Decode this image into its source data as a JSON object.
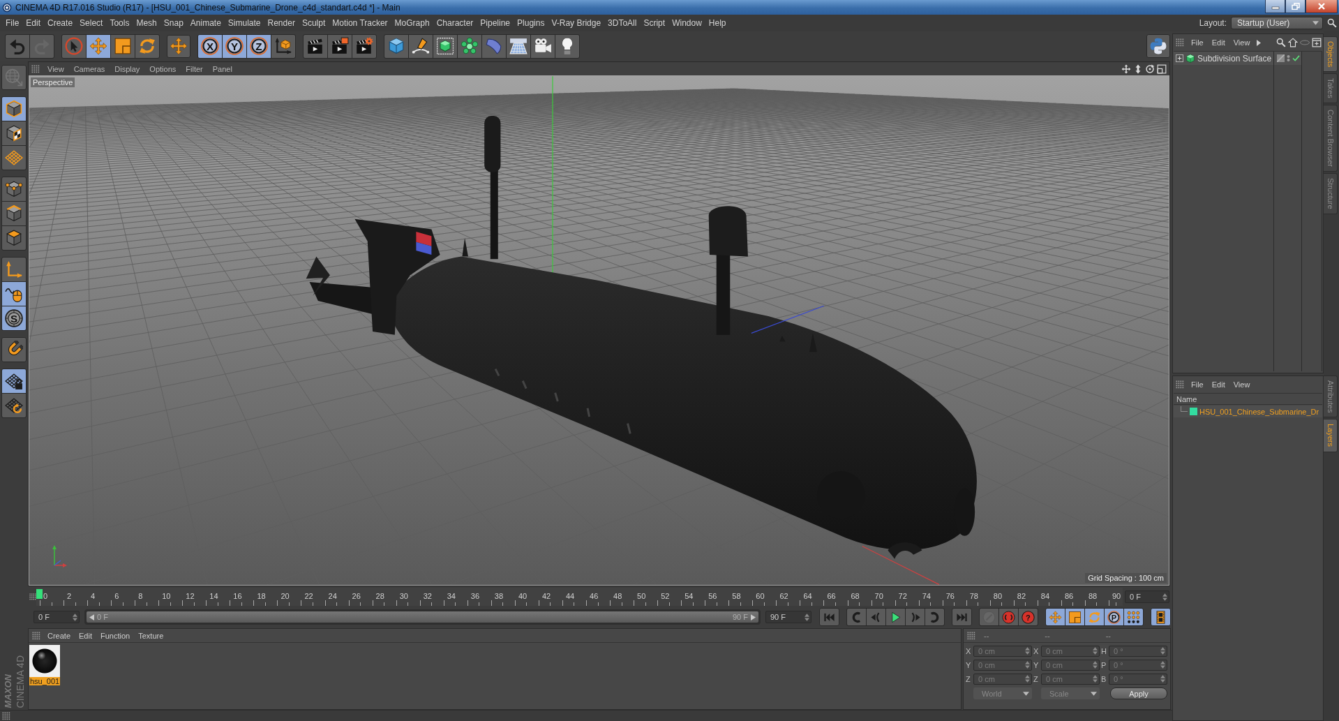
{
  "window": {
    "title": "CINEMA 4D R17.016 Studio (R17) - [HSU_001_Chinese_Submarine_Drone_c4d_standart.c4d *] - Main"
  },
  "menu_bar": {
    "items": [
      "File",
      "Edit",
      "Create",
      "Select",
      "Tools",
      "Mesh",
      "Snap",
      "Animate",
      "Simulate",
      "Render",
      "Sculpt",
      "Motion Tracker",
      "MoGraph",
      "Character",
      "Pipeline",
      "Plugins",
      "V-Ray Bridge",
      "3DToAll",
      "Script",
      "Window",
      "Help"
    ],
    "layout_label": "Layout:",
    "layout_value": "Startup (User)"
  },
  "toolbar": {
    "groups": [
      [
        {
          "kind": "undo",
          "selected": false,
          "disabled": false
        },
        {
          "kind": "redo",
          "selected": false,
          "disabled": true
        }
      ],
      [
        {
          "kind": "select",
          "selected": false,
          "disabled": false
        },
        {
          "kind": "move",
          "selected": true,
          "disabled": false
        },
        {
          "kind": "scale",
          "selected": false,
          "disabled": false
        },
        {
          "kind": "rotate",
          "selected": false,
          "disabled": false
        }
      ],
      [
        {
          "kind": "last_tool",
          "selected": false,
          "disabled": false
        }
      ],
      [
        {
          "kind": "axis_lock",
          "label": "X",
          "selected": true,
          "disabled": false
        },
        {
          "kind": "axis_lock",
          "label": "Y",
          "selected": true,
          "disabled": false
        },
        {
          "kind": "axis_lock",
          "label": "Z",
          "selected": true,
          "disabled": false
        },
        {
          "kind": "coordinate_system",
          "selected": false,
          "disabled": false
        }
      ],
      [
        {
          "kind": "render_view",
          "selected": false,
          "disabled": false
        },
        {
          "kind": "render_picture_viewer",
          "selected": false,
          "disabled": false
        },
        {
          "kind": "render_settings",
          "selected": false,
          "disabled": false
        }
      ],
      [
        {
          "kind": "cube",
          "selected": false,
          "disabled": false
        },
        {
          "kind": "pen",
          "selected": false,
          "disabled": false
        },
        {
          "kind": "subdivision",
          "selected": false,
          "disabled": false
        },
        {
          "kind": "cloner",
          "selected": false,
          "disabled": false
        },
        {
          "kind": "deformer",
          "selected": false,
          "disabled": false
        },
        {
          "kind": "floor",
          "selected": false,
          "disabled": false
        },
        {
          "kind": "camera",
          "selected": false,
          "disabled": false
        },
        {
          "kind": "light",
          "selected": false,
          "disabled": false
        }
      ]
    ],
    "right_groups": [
      [
        {
          "kind": "python",
          "selected": false,
          "disabled": false
        }
      ]
    ]
  },
  "side_toolbar": {
    "groups": [
      [
        {
          "kind": "make_editable",
          "selected": false,
          "disabled": true
        }
      ],
      [
        {
          "kind": "model",
          "selected": true,
          "disabled": false
        },
        {
          "kind": "texture",
          "selected": false,
          "disabled": false
        },
        {
          "kind": "workplane",
          "selected": false,
          "disabled": false
        }
      ],
      [
        {
          "kind": "points",
          "selected": false,
          "disabled": false
        },
        {
          "kind": "edges",
          "selected": false,
          "disabled": false
        },
        {
          "kind": "polygons",
          "selected": false,
          "disabled": false
        }
      ],
      [
        {
          "kind": "axis",
          "selected": false,
          "disabled": false
        },
        {
          "kind": "tweak",
          "selected": true,
          "disabled": false
        },
        {
          "kind": "solo",
          "label": "S",
          "selected": true,
          "disabled": false
        }
      ],
      [
        {
          "kind": "snap",
          "selected": false,
          "disabled": false
        }
      ],
      [
        {
          "kind": "lock_workplane",
          "selected": true,
          "disabled": false
        },
        {
          "kind": "planar_workplane",
          "selected": false,
          "disabled": false
        }
      ]
    ]
  },
  "viewport": {
    "menu": [
      "View",
      "Cameras",
      "Display",
      "Options",
      "Filter",
      "Panel"
    ],
    "camera": "Perspective",
    "grid_spacing": "Grid Spacing : 100 cm"
  },
  "timeline": {
    "ticks": [
      "0",
      "2",
      "4",
      "6",
      "8",
      "10",
      "12",
      "14",
      "16",
      "18",
      "20",
      "22",
      "24",
      "26",
      "28",
      "30",
      "32",
      "34",
      "36",
      "38",
      "40",
      "42",
      "44",
      "46",
      "48",
      "50",
      "52",
      "54",
      "56",
      "58",
      "60",
      "62",
      "64",
      "66",
      "68",
      "70",
      "72",
      "74",
      "76",
      "78",
      "80",
      "82",
      "84",
      "86",
      "88",
      "90"
    ],
    "level": 0,
    "frame_field": "0 F"
  },
  "playback": {
    "start_field": "0 F",
    "range_start": "0 F",
    "range_end": "90 F",
    "level": 1,
    "end_field": "90 F",
    "groups": [
      [
        {
          "kind": "first",
          "selected": false,
          "disabled": false
        }
      ],
      [
        {
          "kind": "prev_key",
          "selected": false,
          "disabled": false
        },
        {
          "kind": "prev_frame",
          "selected": false,
          "disabled": false
        },
        {
          "kind": "play",
          "selected": false,
          "disabled": false
        },
        {
          "kind": "next_frame",
          "selected": false,
          "disabled": false
        },
        {
          "kind": "next_key",
          "selected": false,
          "disabled": false
        }
      ],
      [
        {
          "kind": "last",
          "selected": false,
          "disabled": false
        }
      ],
      [
        {
          "kind": "autokey",
          "selected": false,
          "disabled": true
        },
        {
          "kind": "record",
          "selected": false,
          "disabled": false
        },
        {
          "kind": "keyframe_help",
          "label": "?",
          "selected": false,
          "disabled": false
        }
      ],
      [
        {
          "kind": "key_position",
          "selected": true,
          "disabled": false
        },
        {
          "kind": "key_scale",
          "selected": true,
          "disabled": false
        },
        {
          "kind": "key_rotation",
          "selected": true,
          "disabled": false
        },
        {
          "kind": "key_parameter",
          "label": "P",
          "selected": true,
          "disabled": false
        },
        {
          "kind": "key_pla",
          "selected": true,
          "disabled": false
        }
      ],
      [
        {
          "kind": "timeline",
          "selected": true,
          "disabled": false
        }
      ]
    ]
  },
  "material_manager": {
    "menu": [
      "Create",
      "Edit",
      "Function",
      "Texture"
    ],
    "materials": [
      {
        "name": "hsu_001",
        "selected": true
      }
    ]
  },
  "coordinates": {
    "disabled": true,
    "header": [
      "--",
      "--",
      "--"
    ],
    "rows": [
      {
        "cells": [
          {
            "label": "X",
            "value": "0 cm"
          },
          {
            "label": "X",
            "value": "0 cm"
          },
          {
            "label": "H",
            "value": "0 °"
          }
        ]
      },
      {
        "cells": [
          {
            "label": "Y",
            "value": "0 cm"
          },
          {
            "label": "Y",
            "value": "0 cm"
          },
          {
            "label": "P",
            "value": "0 °"
          }
        ]
      },
      {
        "cells": [
          {
            "label": "Z",
            "value": "0 cm"
          },
          {
            "label": "Z",
            "value": "0 cm"
          },
          {
            "label": "B",
            "value": "0 °"
          }
        ]
      }
    ],
    "dropdowns": [
      "World",
      "Scale"
    ],
    "button": "Apply"
  },
  "object_manager": {
    "menu": [
      "File",
      "Edit",
      "View"
    ],
    "objects": [
      {
        "name": "Subdivision Surface",
        "expanded": false,
        "enabled": true,
        "selected": false
      }
    ]
  },
  "layer_manager": {
    "menu": [
      "File",
      "Edit",
      "View"
    ],
    "header": "Name",
    "layers": [
      {
        "name": "HSU_001_Chinese_Submarine_Dr",
        "color": "#33dca0",
        "selected": true
      }
    ]
  },
  "side_tabs": {
    "upper": [
      {
        "label": "Objects",
        "selected": true
      },
      {
        "label": "Takes",
        "selected": false
      },
      {
        "label": "Content Browser",
        "selected": false
      },
      {
        "label": "Structure",
        "selected": false
      }
    ],
    "lower": [
      {
        "label": "Attributes",
        "selected": false
      },
      {
        "label": "Layers",
        "selected": true
      }
    ]
  },
  "logo": {
    "brand": "MAXON",
    "product": "CINEMA 4D"
  }
}
